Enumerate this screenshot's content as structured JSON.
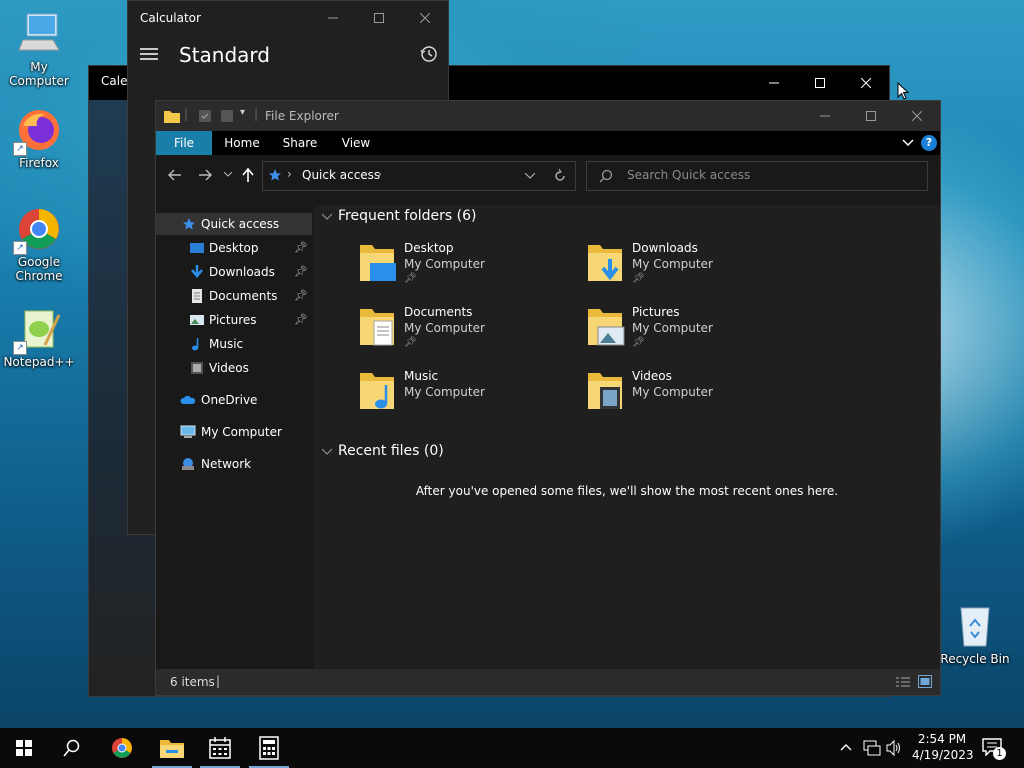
{
  "desktop": {
    "icons": [
      {
        "label": "My Computer"
      },
      {
        "label": "Firefox"
      },
      {
        "label": "Google Chrome"
      },
      {
        "label": "Notepad++"
      },
      {
        "label": "Recycle Bin"
      }
    ]
  },
  "calendar_window": {
    "title": "Calen"
  },
  "calculator": {
    "title": "Calculator",
    "mode": "Standard"
  },
  "explorer": {
    "title": "File Explorer",
    "ribbon_tabs": [
      "File",
      "Home",
      "Share",
      "View"
    ],
    "address": "Quick access",
    "search_placeholder": "Search Quick access",
    "nav": [
      {
        "label": "Quick access",
        "icon": "star-icon",
        "pinned": false
      },
      {
        "label": "Desktop",
        "icon": "desktop-folder-icon",
        "pinned": true
      },
      {
        "label": "Downloads",
        "icon": "download-icon",
        "pinned": true
      },
      {
        "label": "Documents",
        "icon": "documents-icon",
        "pinned": true
      },
      {
        "label": "Pictures",
        "icon": "pictures-icon",
        "pinned": true
      },
      {
        "label": "Music",
        "icon": "music-icon",
        "pinned": false
      },
      {
        "label": "Videos",
        "icon": "videos-icon",
        "pinned": false
      },
      {
        "label": "OneDrive",
        "icon": "cloud-icon",
        "pinned": false
      },
      {
        "label": "My Computer",
        "icon": "computer-icon",
        "pinned": false
      },
      {
        "label": "Network",
        "icon": "network-icon",
        "pinned": false
      }
    ],
    "frequent_header": "Frequent folders (6)",
    "folders": [
      {
        "name": "Desktop",
        "location": "My Computer"
      },
      {
        "name": "Downloads",
        "location": "My Computer"
      },
      {
        "name": "Documents",
        "location": "My Computer"
      },
      {
        "name": "Pictures",
        "location": "My Computer"
      },
      {
        "name": "Music",
        "location": "My Computer"
      },
      {
        "name": "Videos",
        "location": "My Computer"
      }
    ],
    "recent_header": "Recent files (0)",
    "recent_empty": "After you've opened some files, we'll show the most recent ones here.",
    "status": "6 items"
  },
  "taskbar": {
    "time": "2:54 PM",
    "date": "4/19/2023",
    "notification_count": "1"
  },
  "colors": {
    "accent": "#1c7aa0",
    "folder_yellow": "#f3c84a",
    "quick_access_star": "#3b8ee8"
  }
}
